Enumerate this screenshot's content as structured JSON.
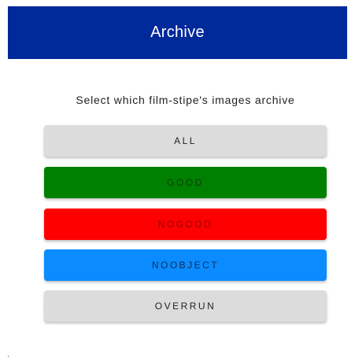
{
  "header": {
    "title": "Archive",
    "background": "#00299a"
  },
  "subtitle": "Select which film-stipe's images archive",
  "buttons": [
    {
      "label": "ALL",
      "bg": "#dcdcdc",
      "fg": "#222222"
    },
    {
      "label": "GOOD",
      "bg": "#008000",
      "fg": "#0a3d0a"
    },
    {
      "label": "NOGOOD",
      "bg": "#ff0000",
      "fg": "#8a0000"
    },
    {
      "label": "NOOBJECT",
      "bg": "#0a8bff",
      "fg": "#0b2f5a"
    },
    {
      "label": "OVERRUN",
      "bg": "#dcdcdc",
      "fg": "#222222"
    }
  ]
}
